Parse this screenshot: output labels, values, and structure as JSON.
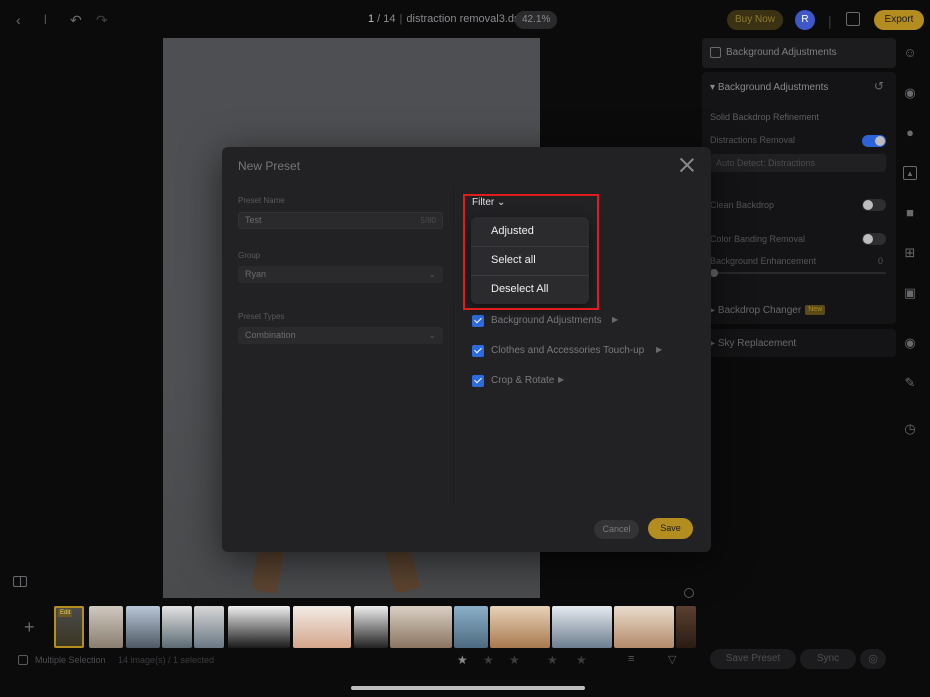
{
  "topbar": {
    "page_current": "1",
    "page_total": "14",
    "filename": "distraction removal3.dng",
    "zoom": "42.1%",
    "buy_now_label": "Buy Now",
    "avatar_initial": "R",
    "export_label": "Export"
  },
  "right_panel": {
    "header_title": "Background Adjustments",
    "section_title": "Background Adjustments",
    "subsection_title": "Solid Backdrop Refinement",
    "distractions_label": "Distractions Removal",
    "distractions_on": true,
    "auto_detect_value": "Auto Detect: Distractions",
    "clean_backdrop_label": "Clean Backdrop",
    "clean_backdrop_on": false,
    "color_banding_label": "Color Banding Removal",
    "color_banding_on": false,
    "bg_enhancement_label": "Background Enhancement",
    "bg_enhancement_value": "0",
    "backdrop_changer_label": "Backdrop Changer",
    "new_badge": "New",
    "sky_replacement_label": "Sky Replacement",
    "save_preset_label": "Save Preset",
    "sync_label": "Sync"
  },
  "rail_icons": [
    "person-icon",
    "palette-icon",
    "face-icon",
    "landscape-icon",
    "outfit-icon",
    "crop-icon",
    "camera-icon",
    "hair-icon",
    "pen-icon",
    "clock-icon"
  ],
  "filmstrip": {
    "selected_badge": "Edit"
  },
  "statusbar": {
    "multiple_selection_label": "Multiple Selection",
    "count_label": "14 image(s) / 1 selected"
  },
  "modal": {
    "title": "New Preset",
    "preset_name_label": "Preset Name",
    "preset_name_value": "Test",
    "preset_name_count": "5/80",
    "group_label": "Group",
    "group_value": "Ryan",
    "preset_types_label": "Preset Types",
    "preset_types_value": "Combination",
    "filter_label": "Filter",
    "checklist": [
      {
        "label": "Background Adjustments",
        "checked": true
      },
      {
        "label": "Clothes and Accessories Touch-up",
        "checked": true
      },
      {
        "label": "Crop & Rotate",
        "checked": true
      }
    ],
    "cancel_label": "Cancel",
    "save_label": "Save"
  },
  "filter_dropdown": {
    "options": [
      "Adjusted",
      "Select all",
      "Deselect All"
    ]
  },
  "colors": {
    "accent_gold": "#b48d20",
    "toggle_blue": "#2c63d8",
    "checkbox_blue": "#2d6ce0",
    "highlight_red": "#e01c1c"
  }
}
